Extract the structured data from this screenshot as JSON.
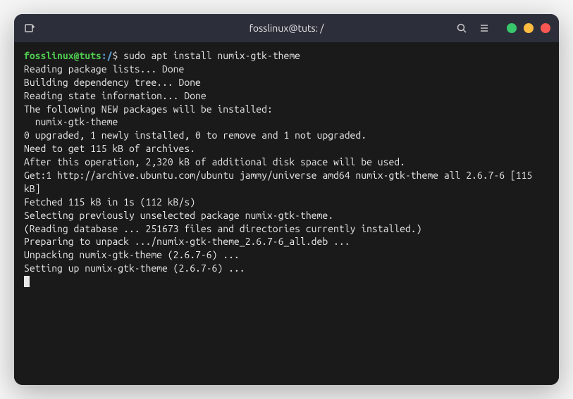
{
  "titlebar": {
    "title": "fosslinux@tuts: /"
  },
  "prompt": {
    "user_host": "fosslinux@tuts",
    "path": ":/",
    "symbol": "$ ",
    "command": "sudo apt install numix-gtk-theme"
  },
  "output": {
    "lines": [
      "Reading package lists... Done",
      "Building dependency tree... Done",
      "Reading state information... Done",
      "The following NEW packages will be installed:",
      "  numix-gtk-theme",
      "0 upgraded, 1 newly installed, 0 to remove and 1 not upgraded.",
      "Need to get 115 kB of archives.",
      "After this operation, 2,320 kB of additional disk space will be used.",
      "Get:1 http://archive.ubuntu.com/ubuntu jammy/universe amd64 numix-gtk-theme all 2.6.7-6 [115 kB]",
      "Fetched 115 kB in 1s (112 kB/s)",
      "Selecting previously unselected package numix-gtk-theme.",
      "(Reading database ... 251673 files and directories currently installed.)",
      "Preparing to unpack .../numix-gtk-theme_2.6.7-6_all.deb ...",
      "Unpacking numix-gtk-theme (2.6.7-6) ...",
      "Setting up numix-gtk-theme (2.6.7-6) ..."
    ]
  }
}
